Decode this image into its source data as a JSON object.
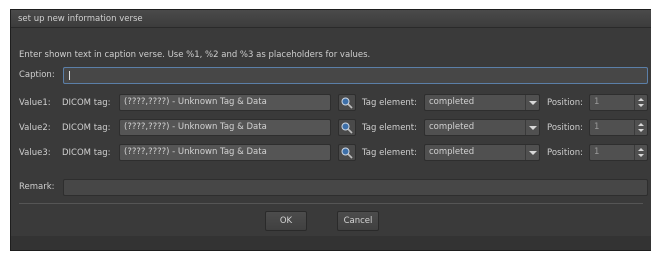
{
  "window": {
    "title": "set up new information verse"
  },
  "instructions": "Enter shown text in caption verse. Use %1, %2 and %3 as placeholders for values.",
  "caption": {
    "label": "Caption:",
    "value": ""
  },
  "values": [
    {
      "label": "Value1:",
      "dicom_label": "DICOM tag:",
      "dicom_value": "(????,????) - Unknown Tag & Data",
      "tag_label": "Tag element:",
      "tag_value": "completed",
      "pos_label": "Position:",
      "pos_value": "1"
    },
    {
      "label": "Value2:",
      "dicom_label": "DICOM tag:",
      "dicom_value": "(????,????) - Unknown Tag & Data",
      "tag_label": "Tag element:",
      "tag_value": "completed",
      "pos_label": "Position:",
      "pos_value": "1"
    },
    {
      "label": "Value3:",
      "dicom_label": "DICOM tag:",
      "dicom_value": "(????,????) - Unknown Tag & Data",
      "tag_label": "Tag element:",
      "tag_value": "completed",
      "pos_label": "Position:",
      "pos_value": "1"
    }
  ],
  "remark": {
    "label": "Remark:",
    "value": ""
  },
  "buttons": {
    "ok": "OK",
    "cancel": "Cancel"
  },
  "icons": {
    "dicom_picker": "magnifier-icon",
    "dropdown": "chevron-down-icon",
    "spinner": "spin-arrows-icon"
  }
}
